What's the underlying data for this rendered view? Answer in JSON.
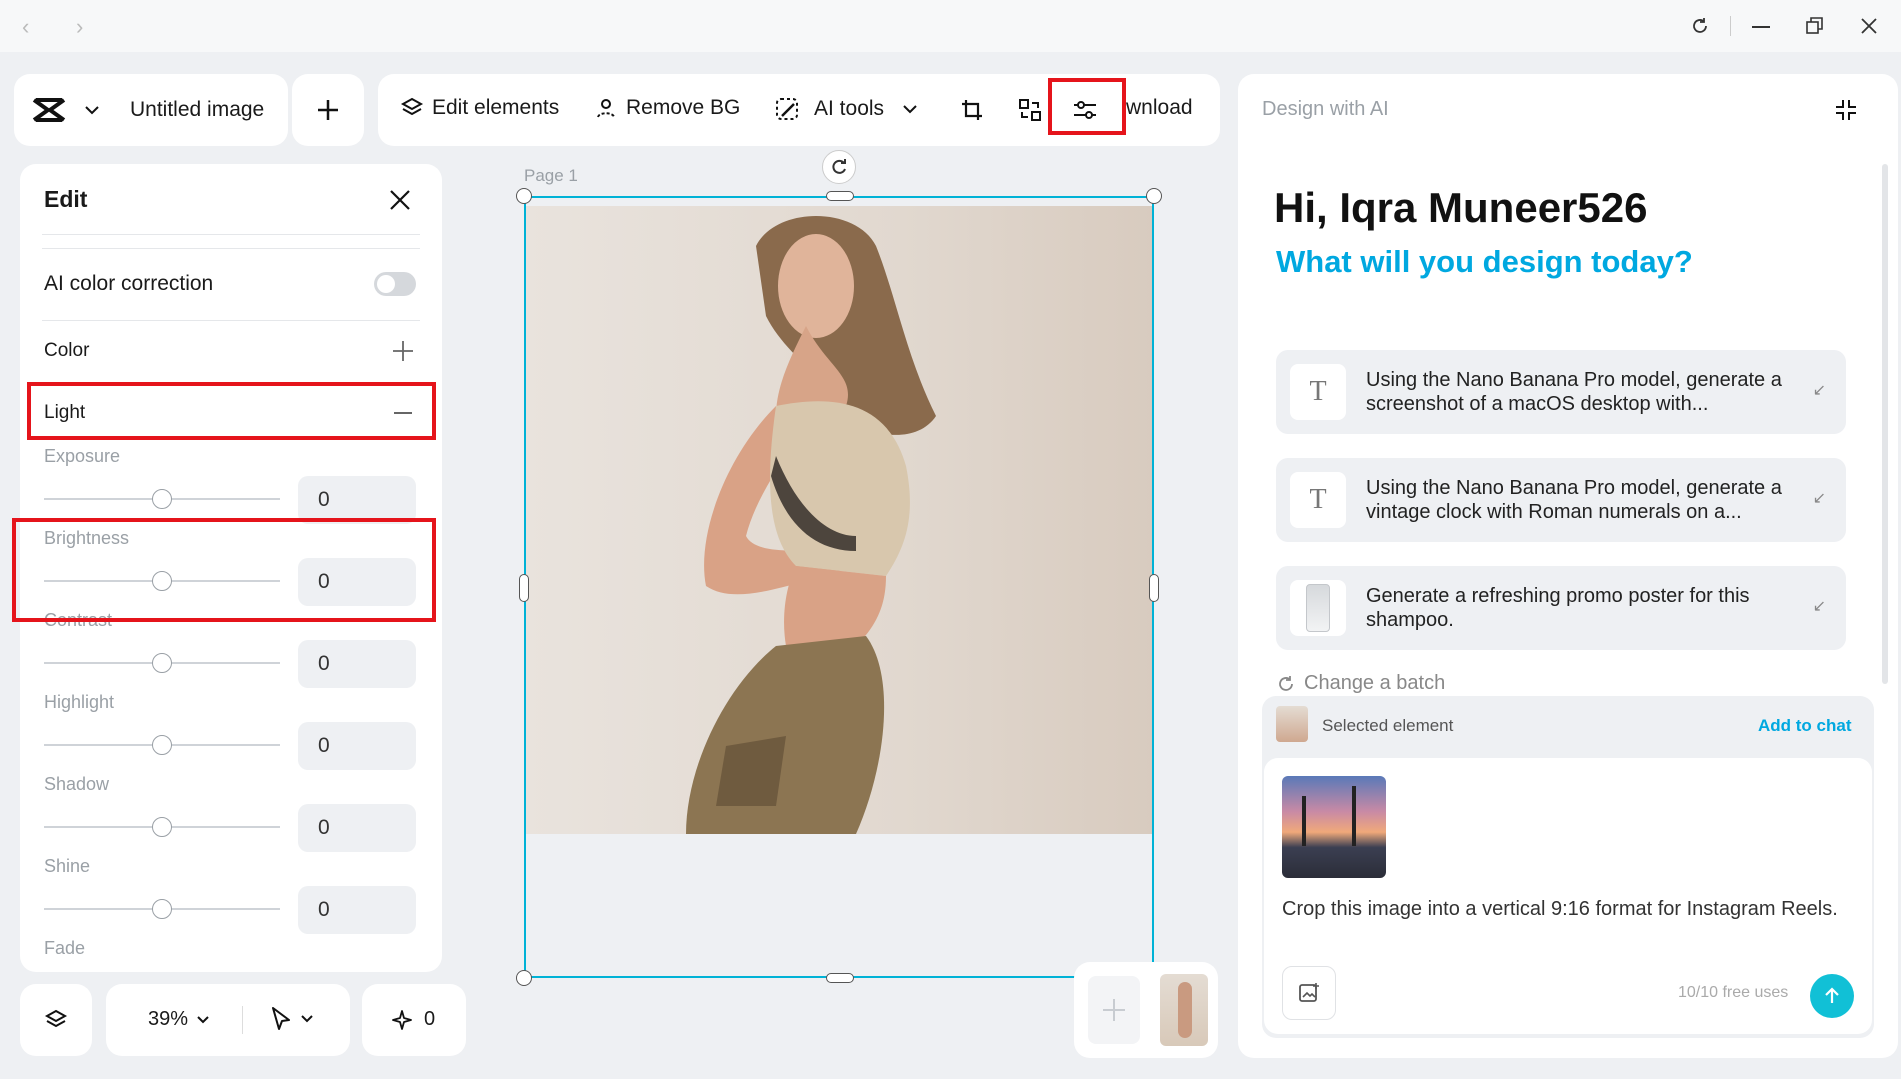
{
  "window": {
    "controls": [
      "back-icon",
      "forward-icon",
      "refresh-icon",
      "minimize-icon",
      "restore-icon",
      "close-icon"
    ]
  },
  "header": {
    "doc_title": "Untitled image",
    "add_label": "+"
  },
  "toolbar": {
    "edit_elements": "Edit elements",
    "remove_bg": "Remove BG",
    "ai_tools": "AI tools",
    "download": "wnload"
  },
  "edit_panel": {
    "title": "Edit",
    "ai_color_correction": "AI color correction",
    "ai_color_correction_on": false,
    "color": "Color",
    "light": "Light",
    "sliders": [
      {
        "label": "Exposure",
        "value": "0"
      },
      {
        "label": "Brightness",
        "value": "0"
      },
      {
        "label": "Contrast",
        "value": "0"
      },
      {
        "label": "Highlight",
        "value": "0"
      },
      {
        "label": "Shadow",
        "value": "0"
      },
      {
        "label": "Shine",
        "value": "0"
      }
    ],
    "fade": "Fade"
  },
  "canvas": {
    "page_label": "Page 1"
  },
  "bottom_bar": {
    "zoom": "39%",
    "sparkle_count": "0"
  },
  "ai_panel": {
    "header": "Design with AI",
    "greeting": "Hi, Iqra Muneer526",
    "subtitle": "What will you design today?",
    "suggestions": [
      {
        "text": "Using the Nano Banana Pro model, generate a screenshot of a macOS desktop with...",
        "icon": "T"
      },
      {
        "text": "Using the Nano Banana Pro model, generate a vintage clock with Roman numerals on a...",
        "icon": "T"
      },
      {
        "text": "Generate a refreshing promo poster for this shampoo.",
        "icon": "shampoo-thumb"
      }
    ],
    "change_batch": "Change a batch",
    "selected_element": "Selected element",
    "add_to_chat": "Add to chat",
    "prompt_text": "Crop this image into a vertical 9:16 format for Instagram Reels.",
    "free_uses": "10/10 free uses"
  },
  "colors": {
    "accent": "#00b2d6",
    "highlight_red": "#e5141b",
    "bg": "#eef0f3"
  }
}
